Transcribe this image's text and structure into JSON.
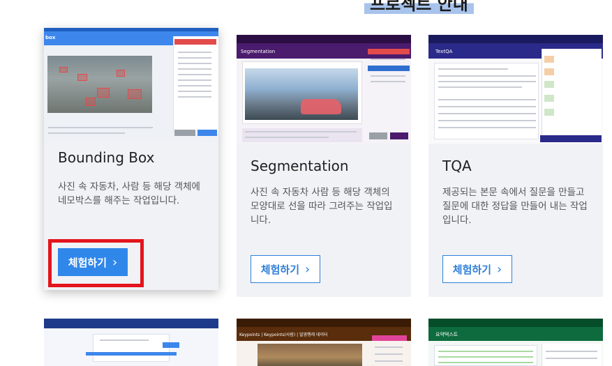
{
  "page": {
    "heading": "프로젝트 안내"
  },
  "cards": [
    {
      "title": "Bounding Box",
      "description": "사진 속 자동차, 사람 등 해당 객체에 네모박스를 해주는 작업입니다.",
      "button_label": "체험하기",
      "thumb_label": "box",
      "accent": "#3d86ec"
    },
    {
      "title": "Segmentation",
      "description": "사진 속 자동차 사람 등 해당 객체의 모양대로 선을 따라 그려주는 작업입니다.",
      "button_label": "체험하기",
      "thumb_label": "Segmentation",
      "accent": "#4b1b6e"
    },
    {
      "title": "TQA",
      "description": "제공되는 본문 속에서 질문을 만들고 질문에 대한 정답을 만들어 내는 작업입니다.",
      "button_label": "체험하기",
      "thumb_label": "TextQA",
      "accent": "#2a2a8a"
    }
  ],
  "bottom_thumbs": [
    {
      "accent": "#1e3a8a"
    },
    {
      "label": "Keypoints | Keypoints(사람) | 밀영행레 데이터",
      "accent": "#5a2d0c"
    },
    {
      "label": "요약텍스트",
      "accent": "#0d6b3d"
    }
  ],
  "colors": {
    "link_blue": "#2f7fd8",
    "highlight_red": "#e3141c",
    "card_bg": "#f1f2f6"
  },
  "icons": {
    "chevron": "›"
  }
}
